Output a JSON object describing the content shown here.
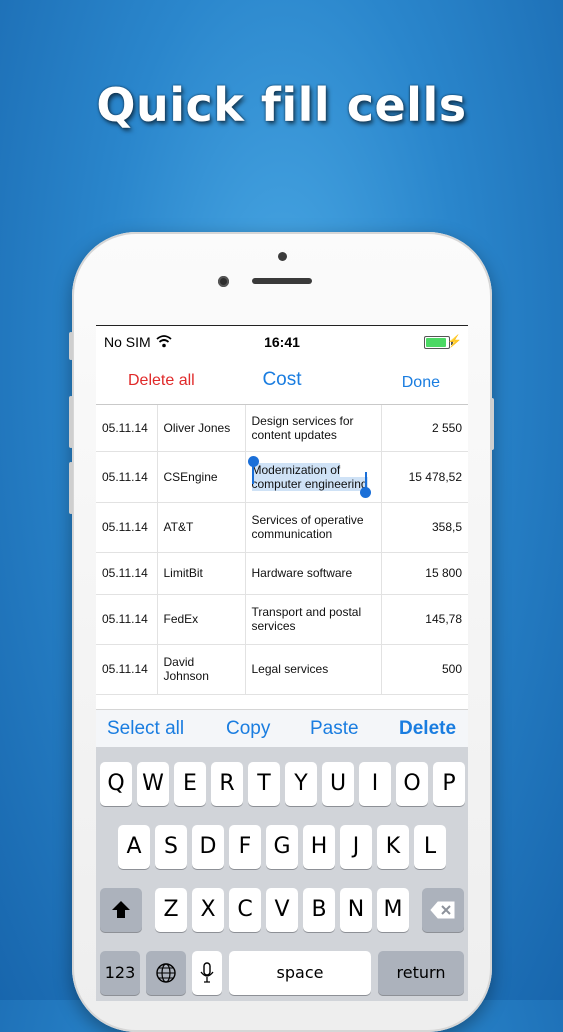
{
  "headline": "Quick fill cells",
  "status": {
    "carrier": "No SIM",
    "time": "16:41",
    "battery_level": 1.0
  },
  "navbar": {
    "left": "Delete all",
    "title": "Cost",
    "right": "Done"
  },
  "rows": [
    {
      "date": "05.11.14",
      "name": "Oliver Jones",
      "desc": "Design services for content updates",
      "amount": "2 550"
    },
    {
      "date": "05.11.14",
      "name": "CSEngine",
      "desc": "Modernization of computer engineering",
      "amount": "15 478,52",
      "selected": true
    },
    {
      "date": "05.11.14",
      "name": "AT&T",
      "desc": "Services of operative communication",
      "amount": "358,5"
    },
    {
      "date": "05.11.14",
      "name": "LimitBit",
      "desc": "Hardware software",
      "amount": "15 800"
    },
    {
      "date": "05.11.14",
      "name": "FedEx",
      "desc": "Transport and postal services",
      "amount": "145,78"
    },
    {
      "date": "05.11.14",
      "name": "David Johnson",
      "desc": "Legal services",
      "amount": "500"
    }
  ],
  "edit_bar": {
    "select_all": "Select all",
    "copy": "Copy",
    "paste": "Paste",
    "delete": "Delete"
  },
  "keyboard": {
    "row1": [
      "Q",
      "W",
      "E",
      "R",
      "T",
      "Y",
      "U",
      "I",
      "O",
      "P"
    ],
    "row2": [
      "A",
      "S",
      "D",
      "F",
      "G",
      "H",
      "J",
      "K",
      "L"
    ],
    "row3": [
      "Z",
      "X",
      "C",
      "V",
      "B",
      "N",
      "M"
    ],
    "numbers": "123",
    "space": "space",
    "return": "return"
  },
  "icons": {
    "wifi": "wifi-icon",
    "battery": "battery-icon",
    "shift": "shift-icon",
    "backspace": "backspace-icon",
    "globe": "globe-icon",
    "mic": "microphone-icon"
  },
  "colors": {
    "accent": "#1a7de0",
    "destructive": "#e02a2a",
    "selection": "#cfe2f6",
    "background": "#2a86cc"
  }
}
